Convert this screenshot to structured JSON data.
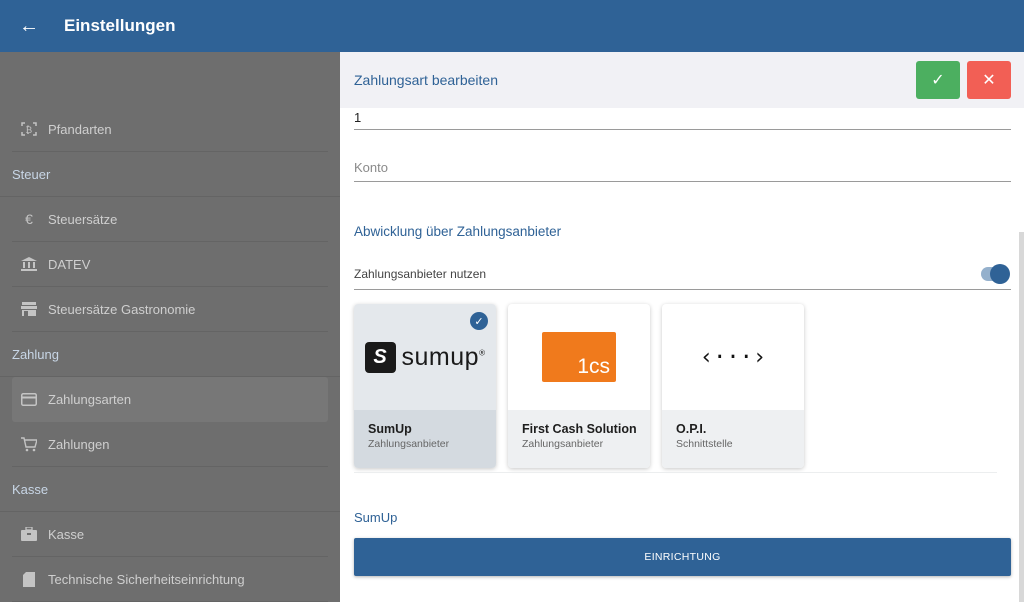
{
  "appbar": {
    "title": "Einstellungen"
  },
  "sidebar": {
    "items": [
      {
        "type": "item",
        "label": "Pfandarten",
        "icon": "deposit-icon"
      },
      {
        "type": "section",
        "label": "Steuer"
      },
      {
        "type": "item",
        "label": "Steuersätze",
        "icon": "euro-icon"
      },
      {
        "type": "item",
        "label": "DATEV",
        "icon": "bank-icon"
      },
      {
        "type": "item",
        "label": "Steuersätze Gastronomie",
        "icon": "shop-icon"
      },
      {
        "type": "section",
        "label": "Zahlung"
      },
      {
        "type": "item",
        "label": "Zahlungsarten",
        "icon": "credit-card-icon",
        "active": true
      },
      {
        "type": "item",
        "label": "Zahlungen",
        "icon": "cart-icon"
      },
      {
        "type": "section",
        "label": "Kasse"
      },
      {
        "type": "item",
        "label": "Kasse",
        "icon": "cash-register-icon"
      },
      {
        "type": "item",
        "label": "Technische Sicherheitseinrichtung",
        "icon": "sd-card-icon"
      }
    ]
  },
  "panel": {
    "title": "Zahlungsart bearbeiten",
    "field_value": "1",
    "konto_placeholder": "Konto",
    "section_title": "Abwicklung über Zahlungsanbieter",
    "toggle_label": "Zahlungsanbieter nutzen",
    "toggle_on": true,
    "cards": [
      {
        "name": "SumUp",
        "type": "Zahlungsanbieter",
        "logo_text": "sumup",
        "selected": true
      },
      {
        "name": "First Cash Solution",
        "type": "Zahlungsanbieter",
        "logo_text": "1cs",
        "selected": false
      },
      {
        "name": "O.P.I.",
        "type": "Schnittstelle",
        "logo_text": "‹···›",
        "selected": false
      }
    ],
    "provider_label": "SumUp",
    "setup_button": "EINRICHTUNG"
  },
  "colors": {
    "primary": "#2f6296",
    "confirm": "#4caf60",
    "cancel": "#f25f55",
    "fcs_orange": "#f07a1c"
  }
}
